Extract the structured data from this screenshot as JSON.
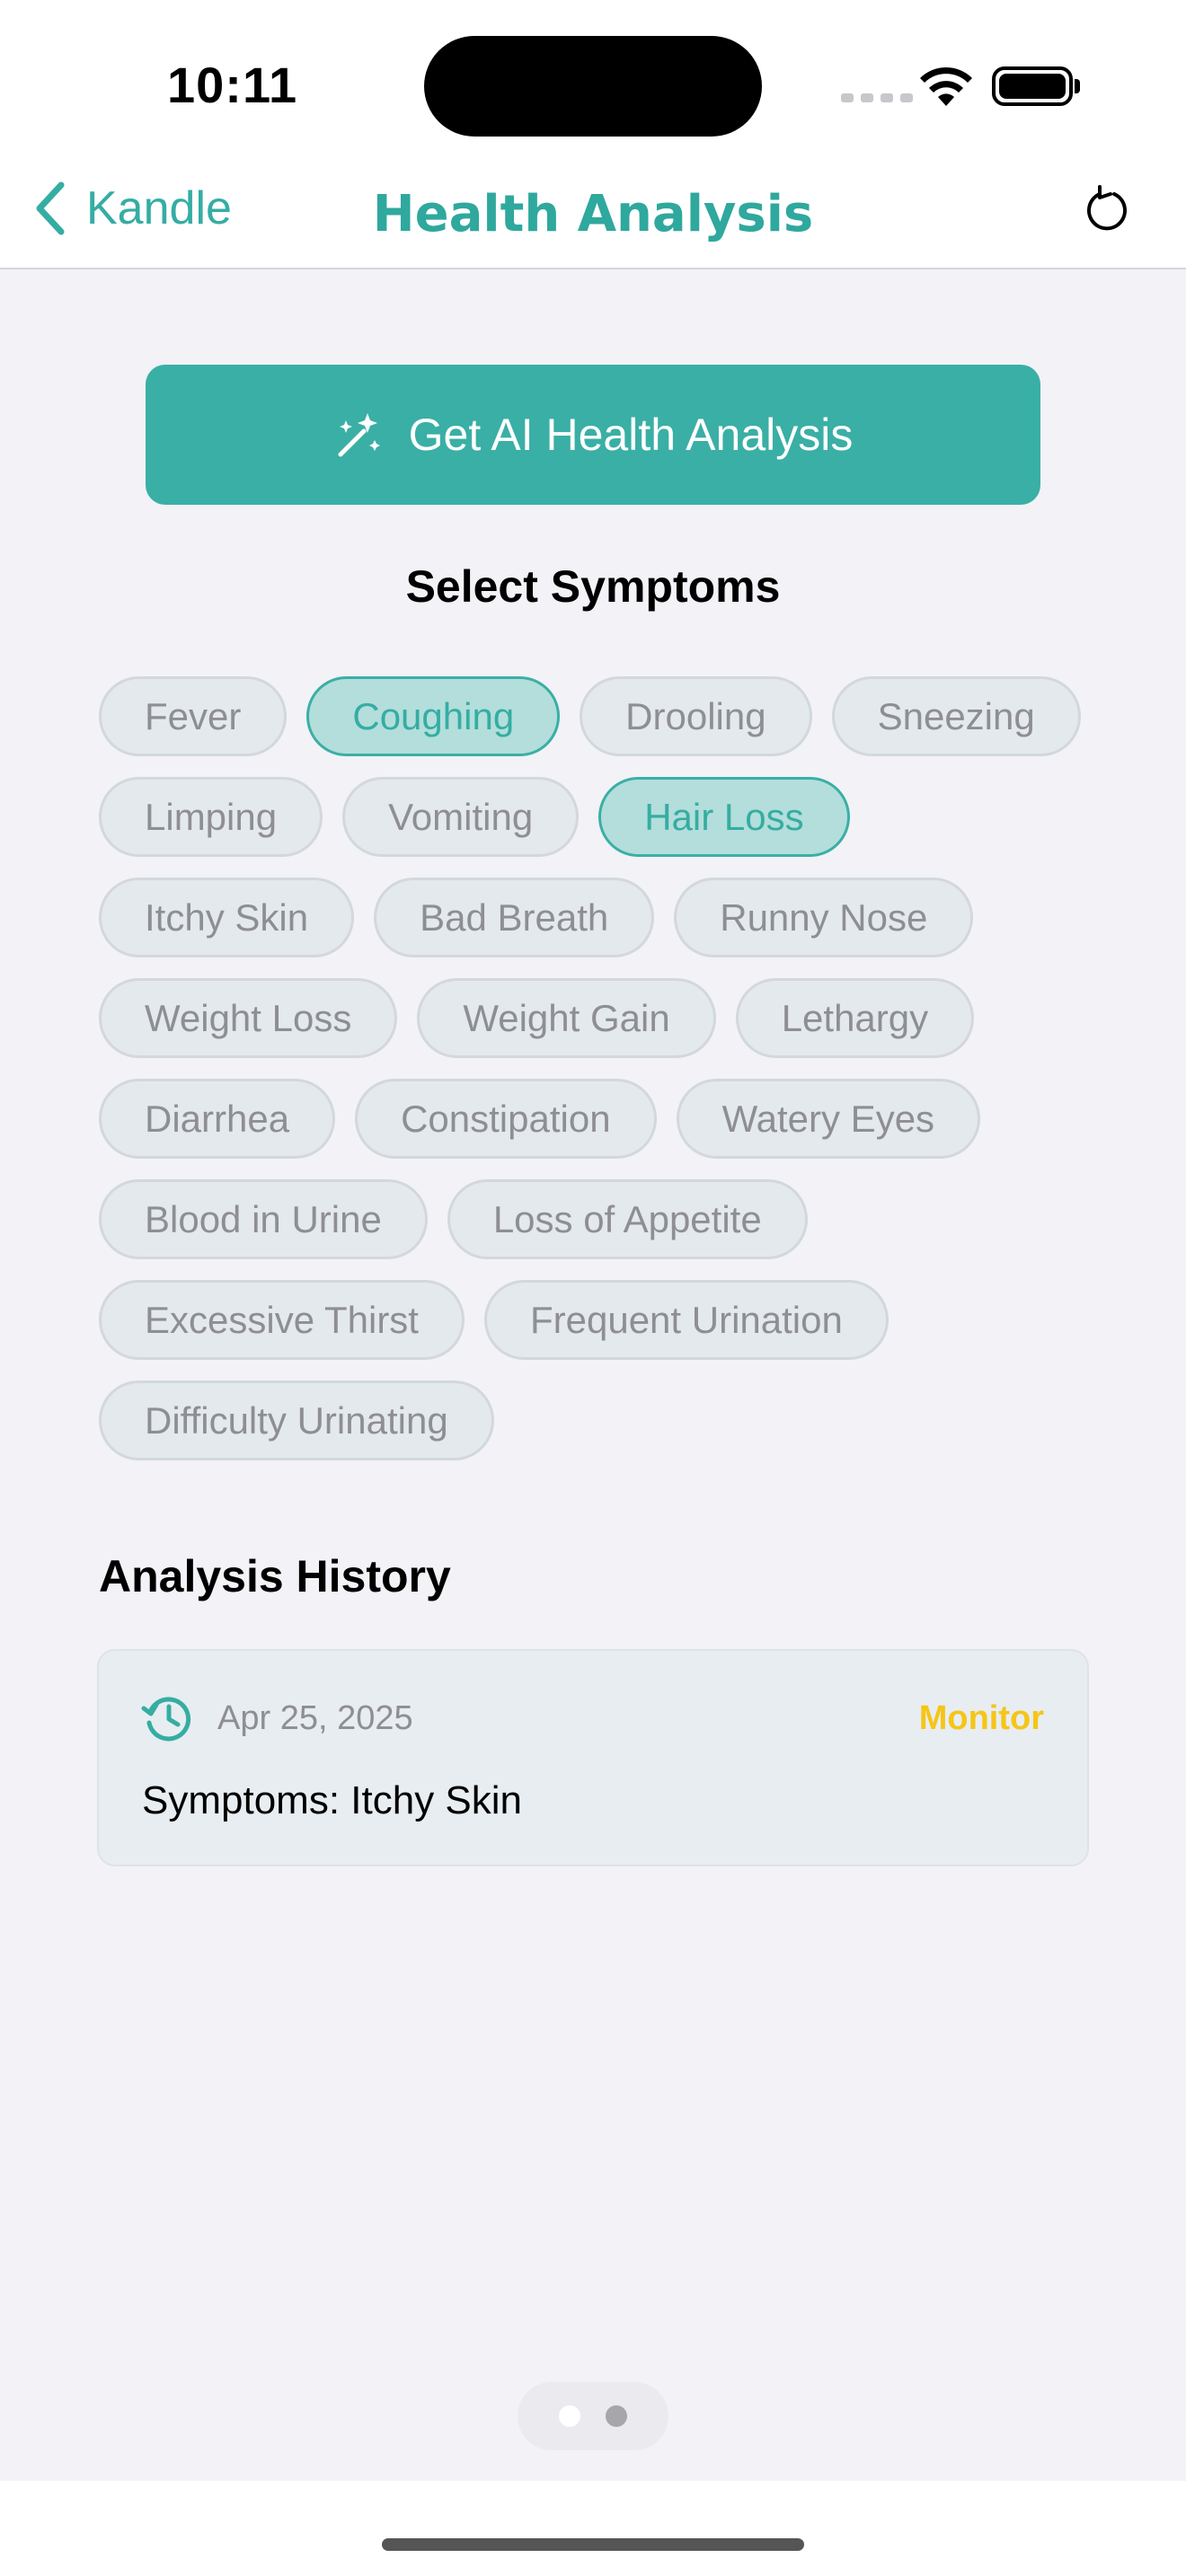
{
  "status_bar": {
    "time": "10:11"
  },
  "nav": {
    "back_label": "Kandle",
    "title": "Health Analysis",
    "back_icon": "chevron-left-icon",
    "refresh_icon": "refresh-icon"
  },
  "ai_button": {
    "label": "Get AI Health Analysis",
    "icon": "magic-wand-icon"
  },
  "symptoms": {
    "title": "Select Symptoms",
    "items": [
      {
        "label": "Fever",
        "selected": false
      },
      {
        "label": "Coughing",
        "selected": true
      },
      {
        "label": "Drooling",
        "selected": false
      },
      {
        "label": "Sneezing",
        "selected": false
      },
      {
        "label": "Limping",
        "selected": false
      },
      {
        "label": "Vomiting",
        "selected": false
      },
      {
        "label": "Hair Loss",
        "selected": true
      },
      {
        "label": "Itchy Skin",
        "selected": false
      },
      {
        "label": "Bad Breath",
        "selected": false
      },
      {
        "label": "Runny Nose",
        "selected": false
      },
      {
        "label": "Weight Loss",
        "selected": false
      },
      {
        "label": "Weight Gain",
        "selected": false
      },
      {
        "label": "Lethargy",
        "selected": false
      },
      {
        "label": "Diarrhea",
        "selected": false
      },
      {
        "label": "Constipation",
        "selected": false
      },
      {
        "label": "Watery Eyes",
        "selected": false
      },
      {
        "label": "Blood in Urine",
        "selected": false
      },
      {
        "label": "Loss of Appetite",
        "selected": false
      },
      {
        "label": "Excessive Thirst",
        "selected": false
      },
      {
        "label": "Frequent Urination",
        "selected": false
      },
      {
        "label": "Difficulty Urinating",
        "selected": false
      }
    ]
  },
  "history": {
    "title": "Analysis History",
    "entries": [
      {
        "date": "Apr 25, 2025",
        "status": "Monitor",
        "symptoms": "Symptoms: Itchy Skin",
        "icon": "history-clock-icon"
      }
    ]
  },
  "colors": {
    "accent": "#3aafa5",
    "chip_selected_bg": "#b3dedb",
    "chip_bg": "#e3e9ed",
    "status_monitor": "#f5c518"
  },
  "pager": {
    "pages": 2,
    "current": 1
  }
}
